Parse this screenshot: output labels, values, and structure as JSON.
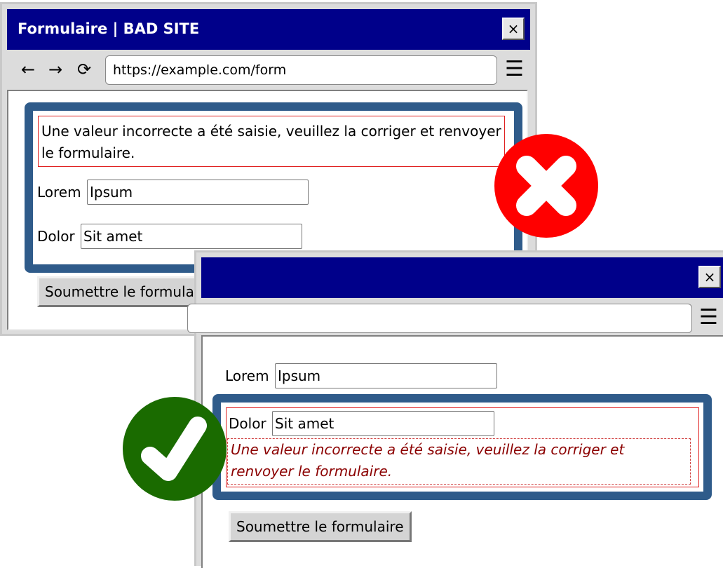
{
  "bad": {
    "title": "Formulaire | BAD SITE",
    "close": "×",
    "nav": {
      "back": "←",
      "forward": "→",
      "reload": "⟳",
      "menu": "☰"
    },
    "url": "https://example.com/form",
    "error": "Une valeur incorrecte a été saisie, veuillez la corriger et renvoyer le formulaire.",
    "fields": [
      {
        "label": "Lorem",
        "value": "Ipsum"
      },
      {
        "label": "Dolor",
        "value": "Sit amet"
      }
    ],
    "submit": "Soumettre le formulaire",
    "badge_icon": "error-cross-icon",
    "badge_color": "#ff0000"
  },
  "good": {
    "close": "×",
    "menu": "☰",
    "fields": [
      {
        "label": "Lorem",
        "value": "Ipsum"
      },
      {
        "label": "Dolor",
        "value": "Sit amet"
      }
    ],
    "error": "Une valeur incorrecte a été saisie, veuillez la corriger et renvoyer le formulaire.",
    "submit": "Soumettre le formulaire",
    "badge_icon": "checkmark-icon",
    "badge_color": "#1a6b00"
  },
  "colors": {
    "titlebar": "#00008a",
    "highlight": "#2f5b8a",
    "error_border": "#e02020",
    "error_text": "#8b0000"
  }
}
